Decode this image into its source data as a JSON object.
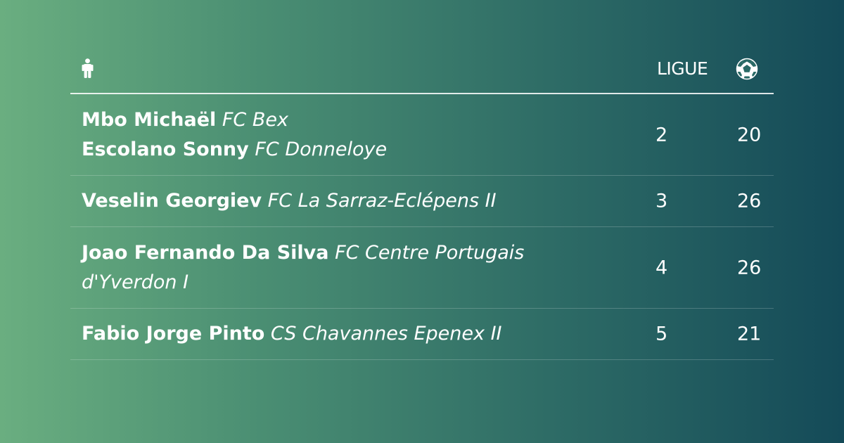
{
  "header": {
    "player_icon": "person-icon",
    "ligue_label": "LIGUE",
    "goals_icon": "soccer-ball-icon"
  },
  "rows": [
    {
      "players": [
        {
          "name": "Mbo Michaël",
          "club": "FC Bex"
        },
        {
          "name": "Escolano Sonny",
          "club": "FC Donneloye"
        }
      ],
      "ligue": "2",
      "goals": "20"
    },
    {
      "players": [
        {
          "name": "Veselin Georgiev",
          "club": "FC La Sarraz-Eclépens II"
        }
      ],
      "ligue": "3",
      "goals": "26"
    },
    {
      "players": [
        {
          "name": "Joao Fernando Da Silva",
          "club": "FC Centre Portugais d'Yverdon I"
        }
      ],
      "ligue": "4",
      "goals": "26"
    },
    {
      "players": [
        {
          "name": "Fabio Jorge Pinto",
          "club": "CS Chavannes Epenex II"
        }
      ],
      "ligue": "5",
      "goals": "21"
    }
  ]
}
